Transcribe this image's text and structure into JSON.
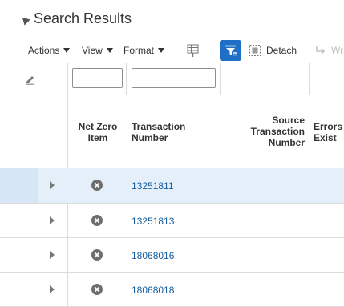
{
  "section": {
    "title": "Search Results"
  },
  "toolbar": {
    "actions_label": "Actions",
    "view_label": "View",
    "format_label": "Format",
    "detach_label": "Detach",
    "wrap_label": "Wra"
  },
  "table": {
    "columns": {
      "net_zero_line1": "Net Zero",
      "net_zero_line2": "Item",
      "txn_line1": "Transaction",
      "txn_line2": "Number",
      "src_line1": "Source",
      "src_line2": "Transaction",
      "src_line3": "Number",
      "err_line1": "Errors",
      "err_line2": "Exist"
    },
    "rows": [
      {
        "transaction_number": "13251811",
        "net_zero_icon": "x-circle-icon"
      },
      {
        "transaction_number": "13251813",
        "net_zero_icon": "x-circle-icon"
      },
      {
        "transaction_number": "18068016",
        "net_zero_icon": "x-circle-icon"
      },
      {
        "transaction_number": "18068018",
        "net_zero_icon": "x-circle-icon"
      }
    ]
  },
  "colors": {
    "accent": "#1f6fc7",
    "link": "#145c9e",
    "selected_row": "#e4eff9"
  }
}
